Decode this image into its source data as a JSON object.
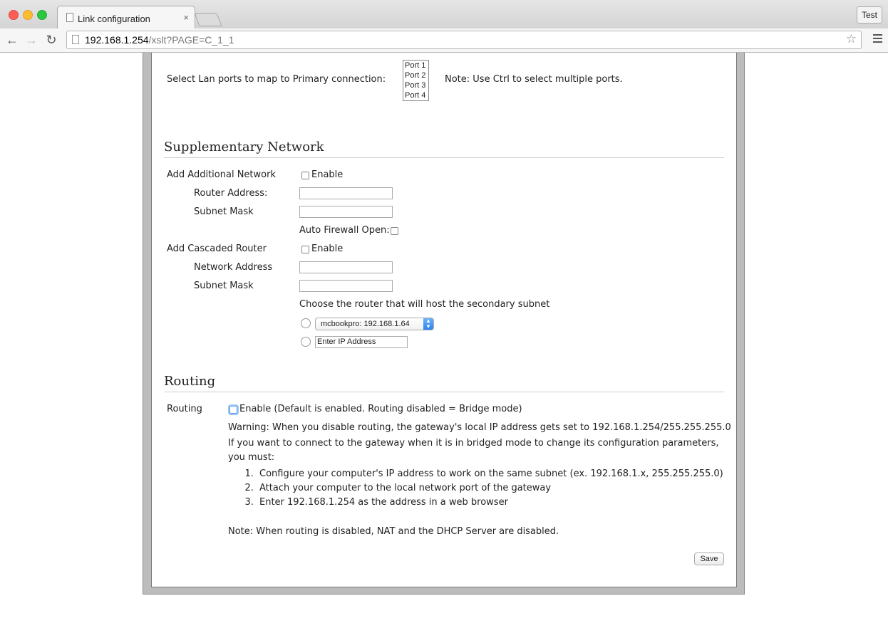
{
  "browser": {
    "tab_title": "Link configuration",
    "tab_close": "×",
    "profile_label": "Test",
    "url_host": "192.168.1.254",
    "url_path": "/xslt?PAGE=C_1_1",
    "icons": [
      "page-icon",
      "close-icon",
      "back-arrow-icon",
      "forward-arrow-icon",
      "reload-icon",
      "star-icon",
      "hamburger-menu-icon"
    ]
  },
  "lan": {
    "label": "Select Lan ports to map to Primary connection:",
    "ports": [
      "Port 1",
      "Port 2",
      "Port 3",
      "Port 4"
    ],
    "note": "Note: Use Ctrl to select multiple ports."
  },
  "supplementary": {
    "heading": "Supplementary Network",
    "add_network_label": "Add Additional Network",
    "enable_label": "Enable",
    "router_address_label": "Router Address:",
    "router_address_value": "",
    "subnet_mask_label": "Subnet Mask",
    "subnet_mask_value": "",
    "auto_firewall_label": "Auto Firewall Open:",
    "cascaded_label": "Add Cascaded Router",
    "cascaded_enable_label": "Enable",
    "network_address_label": "Network Address",
    "network_address_value": "",
    "cascaded_subnet_label": "Subnet Mask",
    "cascaded_subnet_value": "",
    "choose_router_label": "Choose the router that will host the secondary subnet",
    "router_select_value": "mcbookpro: 192.168.1.64",
    "ip_placeholder": "Enter IP Address"
  },
  "routing": {
    "heading": "Routing",
    "label": "Routing",
    "enable_text": "Enable (Default is enabled. Routing disabled = Bridge mode)",
    "warning_line1": "Warning: When you disable routing, the gateway's local IP address gets set to 192.168.1.254/255.255.255.0",
    "warning_line2": "If you want to connect to the gateway when it is in bridged mode to change its configuration parameters, you must:",
    "steps": [
      "Configure your computer's IP address to work on the same subnet (ex. 192.168.1.x, 255.255.255.0)",
      "Attach your computer to the local network port of the gateway",
      "Enter 192.168.1.254 as the address in a web browser"
    ],
    "note": "Note: When routing is disabled, NAT and the DHCP Server are disabled.",
    "save_label": "Save"
  }
}
